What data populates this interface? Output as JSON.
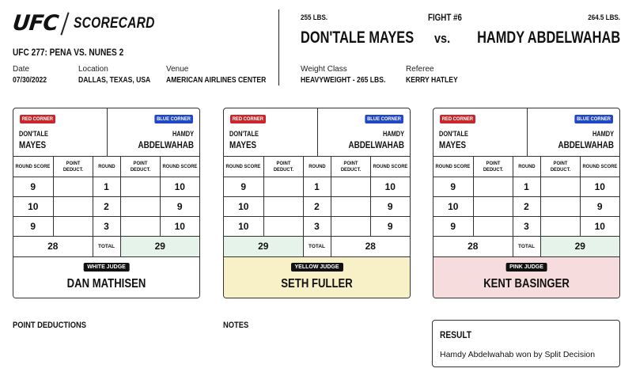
{
  "header": {
    "logo": "UFC",
    "title": "SCORECARD",
    "event": "UFC 277: PENA VS. NUNES 2",
    "date_label": "Date",
    "date": "07/30/2022",
    "location_label": "Location",
    "location": "DALLAS, TEXAS, USA",
    "venue_label": "Venue",
    "venue": "AMERICAN AIRLINES CENTER"
  },
  "fight": {
    "number": "FIGHT #6",
    "vs": "vs.",
    "red_weight": "255 LBS.",
    "blue_weight": "264.5 LBS.",
    "red_name": "DON'TALE MAYES",
    "blue_name": "HAMDY ABDELWAHAB",
    "weight_class_label": "Weight Class",
    "weight_class": "HEAVYWEIGHT - 265 LBS.",
    "referee_label": "Referee",
    "referee": "KERRY HATLEY"
  },
  "labels": {
    "red_corner": "RED CORNER",
    "blue_corner": "BLUE CORNER",
    "red_first": "DON'TALE",
    "red_last": "MAYES",
    "blue_first": "HAMDY",
    "blue_last": "ABDELWAHAB",
    "round_score": "ROUND SCORE",
    "point_deduct": "POINT DEDUCT.",
    "round": "ROUND",
    "total": "TOTAL"
  },
  "cards": [
    {
      "judge_label": "WHITE JUDGE",
      "judge_name": "DAN MATHISEN",
      "rounds": [
        {
          "round": "1",
          "red": "9",
          "blue": "10"
        },
        {
          "round": "2",
          "red": "10",
          "blue": "9"
        },
        {
          "round": "3",
          "red": "9",
          "blue": "10"
        }
      ],
      "red_total": "28",
      "blue_total": "29"
    },
    {
      "judge_label": "YELLOW JUDGE",
      "judge_name": "SETH FULLER",
      "rounds": [
        {
          "round": "1",
          "red": "9",
          "blue": "10"
        },
        {
          "round": "2",
          "red": "10",
          "blue": "9"
        },
        {
          "round": "3",
          "red": "10",
          "blue": "9"
        }
      ],
      "red_total": "29",
      "blue_total": "28"
    },
    {
      "judge_label": "PINK JUDGE",
      "judge_name": "KENT BASINGER",
      "rounds": [
        {
          "round": "1",
          "red": "9",
          "blue": "10"
        },
        {
          "round": "2",
          "red": "10",
          "blue": "9"
        },
        {
          "round": "3",
          "red": "9",
          "blue": "10"
        }
      ],
      "red_total": "28",
      "blue_total": "29"
    }
  ],
  "footer": {
    "deductions_title": "POINT DEDUCTIONS",
    "notes_title": "NOTES",
    "result_title": "RESULT",
    "result_text": "Hamdy Abdelwahab won by Split Decision"
  },
  "colors": {
    "red_corner": "#c8282d",
    "blue_corner": "#1f47c6",
    "win_cell": "#e6f3ea",
    "white_judge_bg": "#ffffff",
    "yellow_judge_bg": "#f8f1c7",
    "pink_judge_bg": "#f6dcdc"
  }
}
